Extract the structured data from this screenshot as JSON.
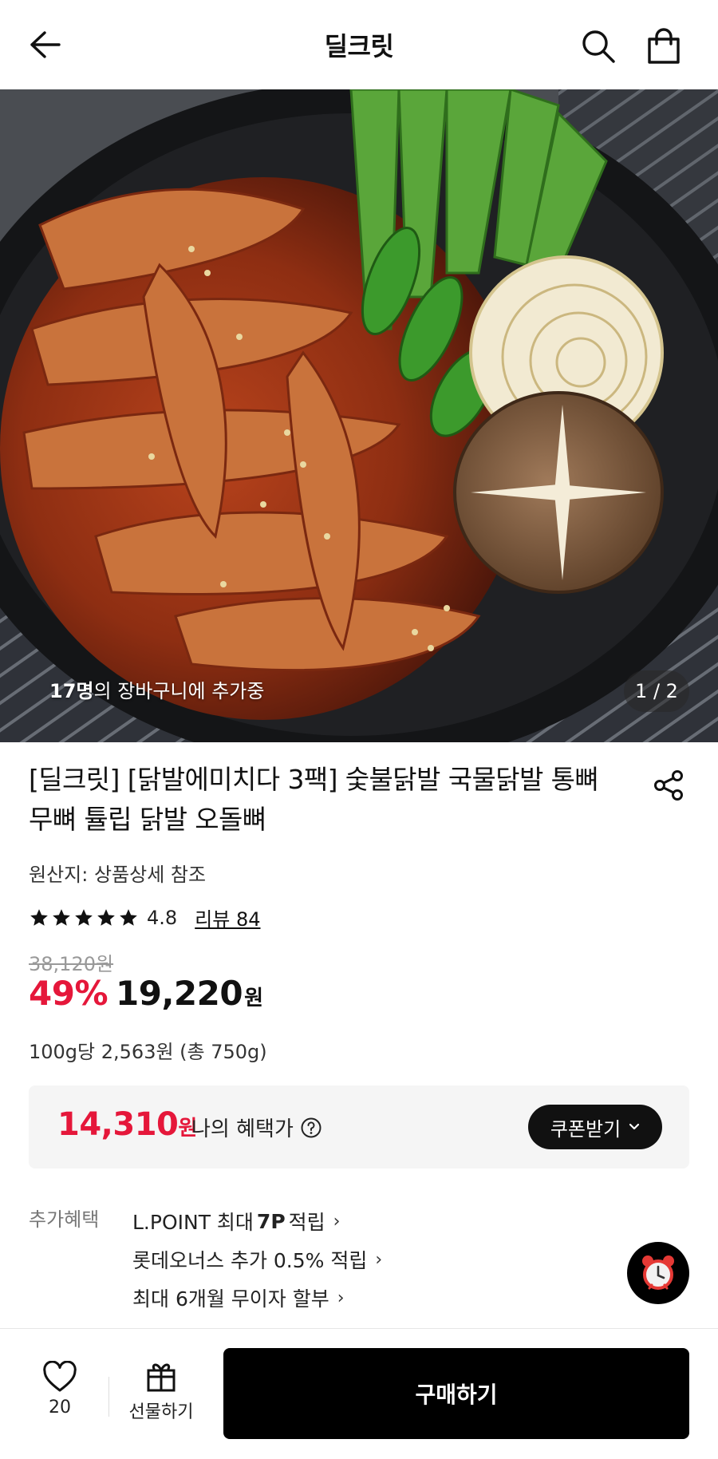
{
  "header": {
    "title": "딜크릿",
    "icons": {
      "back": "arrow-left-icon",
      "search": "search-icon",
      "bag": "shopping-bag-icon"
    }
  },
  "hero": {
    "cart_count": "17명",
    "cart_text": "의 장바구니에 추가중",
    "pager": "1 / 2"
  },
  "product": {
    "title": "[딜크릿] [닭발에미치다 3팩] 숯불닭발 국물닭발 통뼈 무뼈 튤립 닭발 오돌뼈",
    "origin": "원산지: 상품상세 참조",
    "rating": {
      "stars": 5,
      "score": "4.8",
      "review_label": "리뷰 84"
    },
    "original_price": "38,120원",
    "discount": "49%",
    "price": "19,220",
    "price_unit": "원",
    "unit_price": "100g당 2,563원 (총 750g)"
  },
  "benefit": {
    "price": "14,310",
    "price_unit": "원",
    "label": "나의 혜택가",
    "coupon_button": "쿠폰받기"
  },
  "extra": {
    "label": "추가혜택",
    "items": [
      {
        "pre": "L.POINT 최대",
        "bold": "7P",
        "post": "적립"
      },
      {
        "pre": "롯데오너스 추가 0.5% 적립",
        "bold": "",
        "post": ""
      },
      {
        "pre": "최대 6개월 무이자 할부",
        "bold": "",
        "post": ""
      }
    ]
  },
  "bottom": {
    "like_count": "20",
    "gift_label": "선물하기",
    "buy_label": "구매하기"
  },
  "colors": {
    "accent": "#e5173a",
    "dark": "#000000"
  }
}
